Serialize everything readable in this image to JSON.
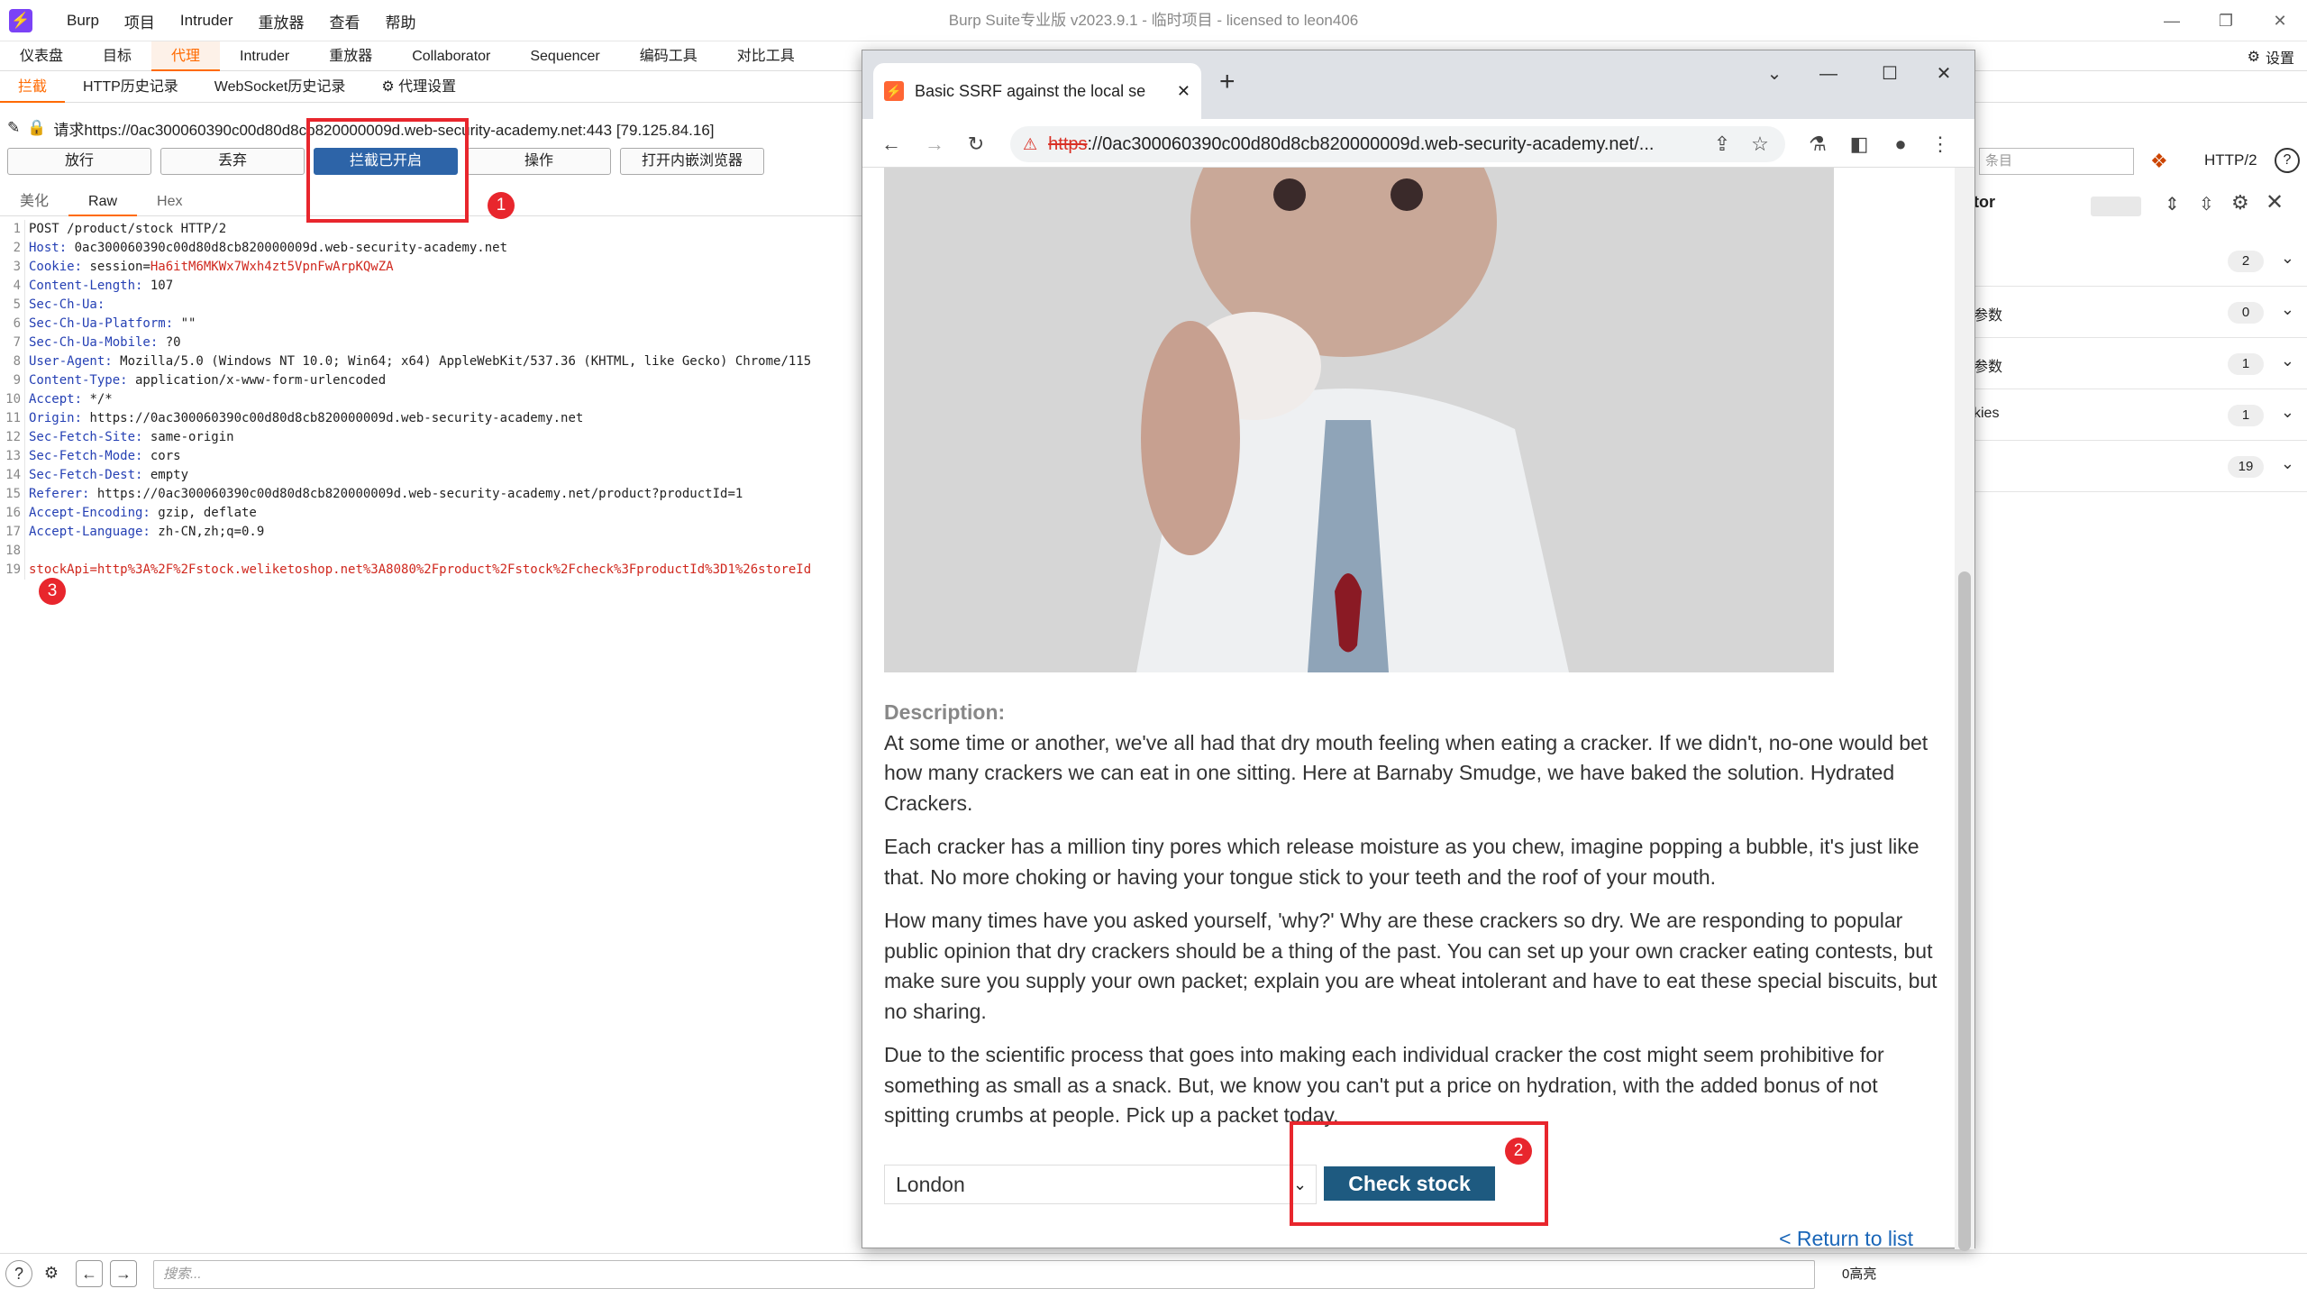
{
  "burp": {
    "logo_icon": "burp-logo-icon",
    "menu": [
      "Burp",
      "项目",
      "Intruder",
      "重放器",
      "查看",
      "帮助"
    ],
    "window_title": "Burp Suite专业版  v2023.9.1 - 临时项目 - licensed to leon406",
    "main_tabs": [
      "仪表盘",
      "目标",
      "代理",
      "Intruder",
      "重放器",
      "Collaborator",
      "Sequencer",
      "编码工具",
      "对比工具"
    ],
    "active_main_tab": "代理",
    "settings_label": "设置",
    "sub_tabs": [
      "拦截",
      "HTTP历史记录",
      "WebSocket历史记录",
      "代理设置"
    ],
    "request_line": "请求https://0ac300060390c00d80d8cb820000009d.web-security-academy.net:443  [79.125.84.16]",
    "buttons": {
      "forward": "放行",
      "drop": "丢弃",
      "intercept": "拦截已开启",
      "action": "操作",
      "open_browser": "打开内嵌浏览器"
    },
    "view_tabs": [
      "美化",
      "Raw",
      "Hex"
    ],
    "request_lines": [
      {
        "k": "",
        "v": "POST /product/stock HTTP/2"
      },
      {
        "k": "Host:",
        "v": " 0ac300060390c00d80d8cb820000009d.web-security-academy.net"
      },
      {
        "k": "Cookie:",
        "v": " session=",
        "r": "Ha6itM6MKWx7Wxh4zt5VpnFwArpKQwZA"
      },
      {
        "k": "Content-Length:",
        "v": " 107"
      },
      {
        "k": "Sec-Ch-Ua:",
        "v": ""
      },
      {
        "k": "Sec-Ch-Ua-Platform:",
        "v": " \"\""
      },
      {
        "k": "Sec-Ch-Ua-Mobile:",
        "v": " ?0"
      },
      {
        "k": "User-Agent:",
        "v": " Mozilla/5.0 (Windows NT 10.0; Win64; x64) AppleWebKit/537.36 (KHTML, like Gecko) Chrome/115"
      },
      {
        "k": "Content-Type:",
        "v": " application/x-www-form-urlencoded"
      },
      {
        "k": "Accept:",
        "v": " */*"
      },
      {
        "k": "Origin:",
        "v": " https://0ac300060390c00d80d8cb820000009d.web-security-academy.net"
      },
      {
        "k": "Sec-Fetch-Site:",
        "v": " same-origin"
      },
      {
        "k": "Sec-Fetch-Mode:",
        "v": " cors"
      },
      {
        "k": "Sec-Fetch-Dest:",
        "v": " empty"
      },
      {
        "k": "Referer:",
        "v": " https://0ac300060390c00d80d8cb820000009d.web-security-academy.net/product?productId=1"
      },
      {
        "k": "Accept-Encoding:",
        "v": " gzip, deflate"
      },
      {
        "k": "Accept-Language:",
        "v": " zh-CN,zh;q=0.9"
      },
      {
        "k": "",
        "v": ""
      },
      {
        "k": "stockApi",
        "v": "",
        "r": "=http%3A%2F%2Fstock.weliketoshop.net%3A8080%2Fproduct%2Fstock%2Fcheck%3FproductId%3D1%26storeId"
      }
    ],
    "search_placeholder": "搜索...",
    "highlights": "0高亮",
    "right_panel": {
      "search_partial": "条目",
      "http_version": "HTTP/2",
      "title_partial": "tor",
      "rows": [
        {
          "label": "",
          "count": "2"
        },
        {
          "label": "参数",
          "count": "0"
        },
        {
          "label": "参数",
          "count": "1"
        },
        {
          "label": "kies",
          "count": "1"
        },
        {
          "label": "",
          "count": "19"
        }
      ]
    }
  },
  "browser": {
    "tab_title": "Basic SSRF against the local se",
    "url_struck": "https",
    "url_rest": "://0ac300060390c00d80d8cb820000009d.web-security-academy.net/...",
    "description_label": "Description:",
    "paragraphs": [
      "At some time or another, we've all had that dry mouth feeling when eating a cracker. If we didn't, no-one would bet how many crackers we can eat in one sitting. Here at Barnaby Smudge, we have baked the solution. Hydrated Crackers.",
      "Each cracker has a million tiny pores which release moisture as you chew, imagine popping a bubble, it's just like that. No more choking or having your tongue stick to your teeth and the roof of your mouth.",
      "How many times have you asked yourself, 'why?' Why are these crackers so dry. We are responding to popular public opinion that dry crackers should be a thing of the past. You can set up your own cracker eating contests, but make sure you supply your own packet; explain you are wheat intolerant and have to eat these special biscuits, but no sharing.",
      "Due to the scientific process that goes into making each individual cracker the cost might seem prohibitive for something as small as a snack. But, we know you can't put a price on hydration, with the added bonus of not spitting crumbs at people. Pick up a packet today."
    ],
    "store_selected": "London",
    "check_stock": "Check stock",
    "return_link": "< Return to list"
  },
  "annotations": [
    "1",
    "2",
    "3"
  ],
  "colors": {
    "burp_orange": "#ff6a00",
    "intercept_blue": "#2d64a8",
    "annotation_red": "#e8262d",
    "check_btn": "#1e5a80"
  }
}
